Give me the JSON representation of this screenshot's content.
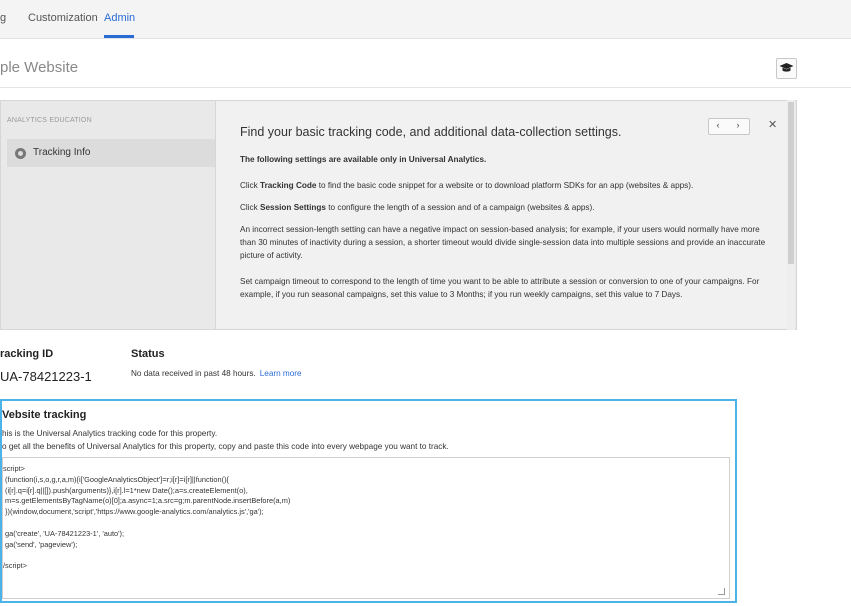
{
  "nav": {
    "tabs": [
      {
        "label": "g"
      },
      {
        "label": "Customization"
      },
      {
        "label": "Admin"
      }
    ]
  },
  "header": {
    "site_title": "ple Website",
    "cap_icon": "graduation-cap-icon"
  },
  "education": {
    "side_heading": "ANALYTICS EDUCATION",
    "item_label": "Tracking Info",
    "heading": "Find your basic tracking code, and additional data-collection settings.",
    "intro": "The following settings are available only in Universal Analytics.",
    "p1_a": "Click ",
    "p1_b": "Tracking Code",
    "p1_c": " to find the basic code snippet for a website or to download platform SDKs for an app (websites & apps).",
    "p2_a": "Click ",
    "p2_b": "Session Settings",
    "p2_c": " to configure the length of a session and of a campaign (websites & apps).",
    "p3": "An incorrect session-length setting can have a negative impact on session-based analysis; for example, if your users would normally have more than 30 minutes of inactivity during a session, a shorter timeout would divide single-session data into multiple sessions and provide an inaccurate picture of activity.",
    "p4": "Set campaign timeout to correspond to the length of time you want to be able to attribute a session or conversion to one of your campaigns. For example, if you run seasonal campaigns, set this value to 3 Months; if you run weekly campaigns, set this value to 7 Days.",
    "prev": "‹",
    "next": "›",
    "close": "✕"
  },
  "tracking": {
    "id_label": "racking ID",
    "id_value": "UA-78421223-1",
    "status_label": "Status",
    "status_text": "No data received in past 48 hours.",
    "learn_more": "Learn more"
  },
  "website_tracking": {
    "title": "Vebsite tracking",
    "line1": "his is the Universal Analytics tracking code for this property.",
    "line2": "o get all the benefits of Universal Analytics for this property, copy and paste this code into every webpage you want to track.",
    "code_lines": [
      "script>",
      " (function(i,s,o,g,r,a,m){i['GoogleAnalyticsObject']=r;i[r]=i[r]||function(){",
      " (i[r].q=i[r].q||[]).push(arguments)},i[r].l=1*new Date();a=s.createElement(o),",
      " m=s.getElementsByTagName(o)[0];a.async=1;a.src=g;m.parentNode.insertBefore(a,m)",
      " })(window,document,'script','https://www.google-analytics.com/analytics.js','ga');",
      "",
      " ga('create', 'UA-78421223-1', 'auto');",
      " ga('send', 'pageview');",
      "",
      "/script>"
    ]
  },
  "colors": {
    "accent": "#2a6bd6",
    "highlight_border": "#4ab3e8"
  }
}
